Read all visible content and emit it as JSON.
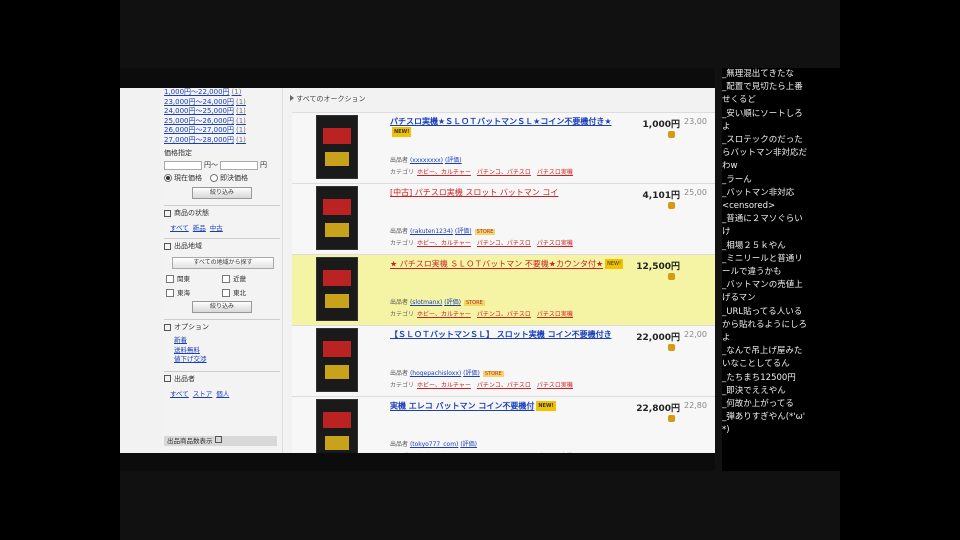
{
  "sidebar": {
    "price_links": [
      {
        "label": "1,000円〜22,000円",
        "count": "(1)"
      },
      {
        "label": "23,000円〜24,000円",
        "count": "(1)"
      },
      {
        "label": "24,000円〜25,000円",
        "count": "(1)"
      },
      {
        "label": "25,000円〜26,000円",
        "count": "(1)"
      },
      {
        "label": "26,000円〜27,000円",
        "count": "(1)"
      },
      {
        "label": "27,000円〜28,000円",
        "count": "(1)"
      }
    ],
    "price_range_label": "価格指定",
    "price_sep": "円〜",
    "price_suffix": "円",
    "radio_current": "現在価格",
    "radio_instant": "即決価格",
    "search_btn": "絞り込み",
    "section_condition": "商品の状態",
    "condition_links": [
      "すべて",
      "新品",
      "中古"
    ],
    "section_area": "出品地域",
    "area_btn": "すべての地域から探す",
    "checkboxes": [
      "関東",
      "近畿",
      "東海",
      "東北"
    ],
    "area_search_btn": "絞り込み",
    "section_options": "オプション",
    "option_links": [
      "新着",
      "送料無料",
      "値下げ交渉"
    ],
    "section_seller": "出品者",
    "seller_links": [
      "すべて",
      "ストア",
      "個人"
    ],
    "footer": "出品商品数表示"
  },
  "main": {
    "breadcrumb": "すべてのオークション",
    "listings": [
      {
        "title": "パチスロ実機★ＳＬＯＴバットマンＳＬ★コイン不要機付き★",
        "new": "NEW!",
        "price": "1,000円",
        "price2": "23,00",
        "seller": "出品者",
        "seller_name": "(xxxxxxxx)",
        "seller_rating": "(評価)",
        "badge": "",
        "cat_prefix": "カテゴリ",
        "cat": [
          "ホビー、カルチャー",
          "パチンコ、パチスロ",
          "パチスロ実機"
        ],
        "highlight": false,
        "plain": false
      },
      {
        "title": "[中古] パチスロ実機 スロット バットマン コイ",
        "new": "",
        "price": "4,101円",
        "price2": "25,00",
        "seller": "出品者",
        "seller_name": "(rakuten1234)",
        "seller_rating": "(評価)",
        "badge": "STORE",
        "cat_prefix": "カテゴリ",
        "cat": [
          "ホビー、カルチャー",
          "パチンコ、パチスロ",
          "パチスロ実機"
        ],
        "highlight": false,
        "plain": true
      },
      {
        "title": "★ パチスロ実機 ＳＬＯＴバットマン 不要機★カウンタ付★",
        "new": "NEW!",
        "price": "12,500円",
        "price2": "",
        "seller": "出品者",
        "seller_name": "(slotmanx)",
        "seller_rating": "(評価)",
        "badge": "STORE",
        "cat_prefix": "カテゴリ",
        "cat": [
          "ホビー、カルチャー",
          "パチンコ、パチスロ",
          "パチスロ実機"
        ],
        "highlight": true,
        "plain": true
      },
      {
        "title": "【ＳＬＯＴバットマンＳＬ】 スロット実機 コイン不要機付き",
        "new": "",
        "price": "22,000円",
        "price2": "22,00",
        "seller": "出品者",
        "seller_name": "(hogepachisloxx)",
        "seller_rating": "(評価)",
        "badge": "STORE",
        "cat_prefix": "カテゴリ",
        "cat": [
          "ホビー、カルチャー",
          "パチンコ、パチスロ",
          "パチスロ実機"
        ],
        "highlight": false,
        "plain": false
      },
      {
        "title": "実機 エレコ バットマン コイン不要機付",
        "new": "NEW!",
        "price": "22,800円",
        "price2": "22,80",
        "seller": "出品者",
        "seller_name": "(tokyo777_com)",
        "seller_rating": "(評価)",
        "badge": "",
        "cat_prefix": "カテゴリ",
        "cat": [
          "ホビー、カルチャー",
          "パチンコ、パチスロ",
          "パチスロ実機"
        ],
        "highlight": false,
        "plain": false
      }
    ]
  },
  "comments": [
    "_無理混出てきたな",
    "_配置で見切たら上番",
    "せくるど",
    "_安い順にソートしろ",
    "よ",
    "_スロテックのだった",
    "らバットマン非対応だ",
    "わw",
    "_ラーん",
    "_バットマン非対応",
    "<censored>",
    "_普通に２マソぐらい",
    "け",
    "_相場２５ｋやん",
    "_ミニリールと普通リ",
    "ールで違うかも",
    "_バットマンの売値上",
    "げるマン",
    "_URL貼ってる人いる",
    "から貼れるようにしろ",
    "よ",
    "_なんで吊上げ屋みた",
    "いなことしてるん",
    "_たちまち12500円",
    "_即決でええやん",
    "_何故か上がってる",
    "_弾ありすぎやん(*'ω'",
    "*)"
  ]
}
